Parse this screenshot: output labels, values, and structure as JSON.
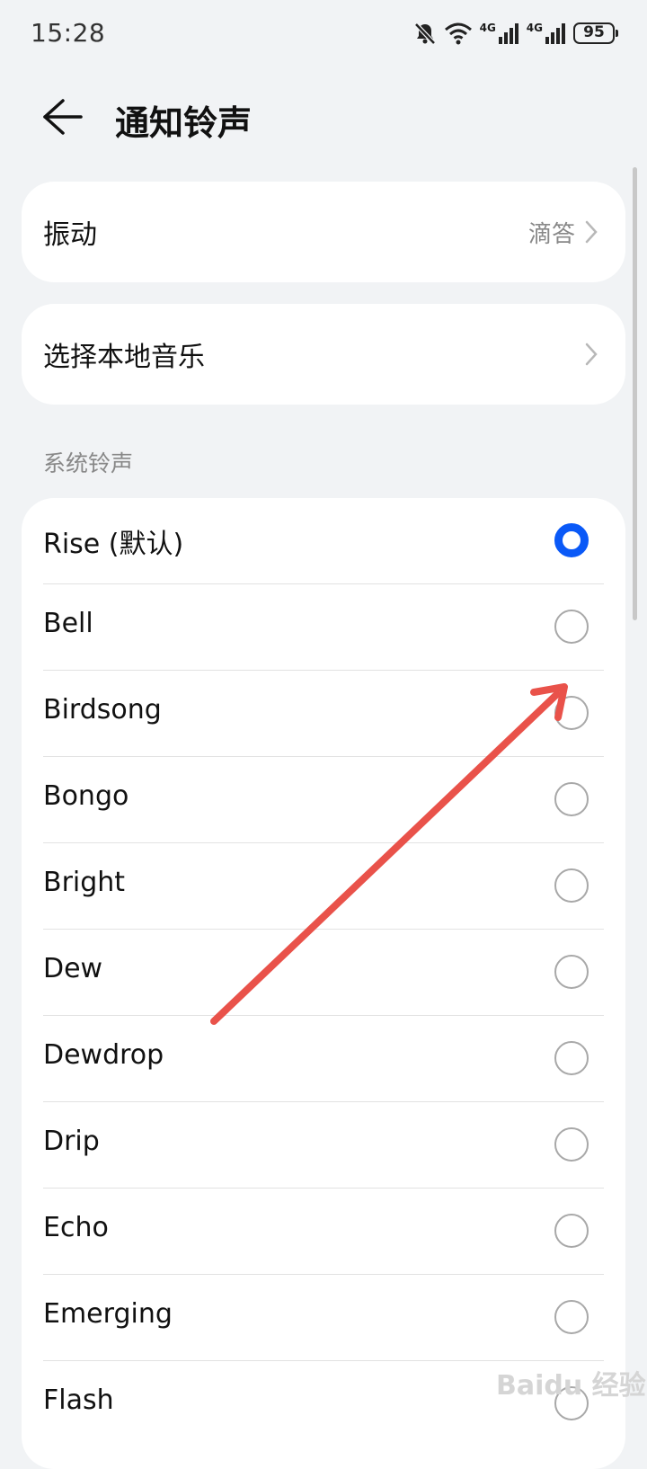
{
  "status": {
    "time": "15:28",
    "battery": "95",
    "net1": "4G",
    "net2": "4G"
  },
  "header": {
    "title": "通知铃声"
  },
  "vibration": {
    "label": "振动",
    "value": "滴答"
  },
  "local_music": {
    "label": "选择本地音乐"
  },
  "section_title": "系统铃声",
  "ringtones": [
    {
      "name": "Rise (默认)",
      "selected": true
    },
    {
      "name": "Bell",
      "selected": false
    },
    {
      "name": "Birdsong",
      "selected": false
    },
    {
      "name": "Bongo",
      "selected": false
    },
    {
      "name": "Bright",
      "selected": false
    },
    {
      "name": "Dew",
      "selected": false
    },
    {
      "name": "Dewdrop",
      "selected": false
    },
    {
      "name": "Drip",
      "selected": false
    },
    {
      "name": "Echo",
      "selected": false
    },
    {
      "name": "Emerging",
      "selected": false
    },
    {
      "name": "Flash",
      "selected": false
    }
  ],
  "watermark": "Baidu 经验",
  "colors": {
    "accent": "#0a59f7",
    "annotation_arrow": "#e9524a",
    "background": "#f1f3f5"
  }
}
